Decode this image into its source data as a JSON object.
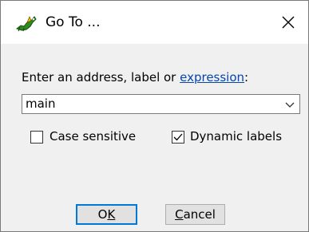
{
  "window": {
    "title": "Go To ...",
    "close_glyph": "✕",
    "app_icon": "dragon-icon"
  },
  "form": {
    "prompt_text": "Enter an address, label or ",
    "prompt_link": "expression",
    "prompt_suffix": ":",
    "address_value": "main"
  },
  "options": {
    "case_sensitive": {
      "label": "Case sensitive",
      "checked": false
    },
    "dynamic_labels": {
      "label": "Dynamic labels",
      "checked": true
    }
  },
  "buttons": {
    "ok_label": "OK",
    "ok_mnemonic": "K",
    "cancel_label": "Cancel",
    "cancel_mnemonic": "C"
  },
  "colors": {
    "link": "#0645ad",
    "default_button_border": "#0078d7",
    "dialog_background": "#f0f0f0"
  }
}
